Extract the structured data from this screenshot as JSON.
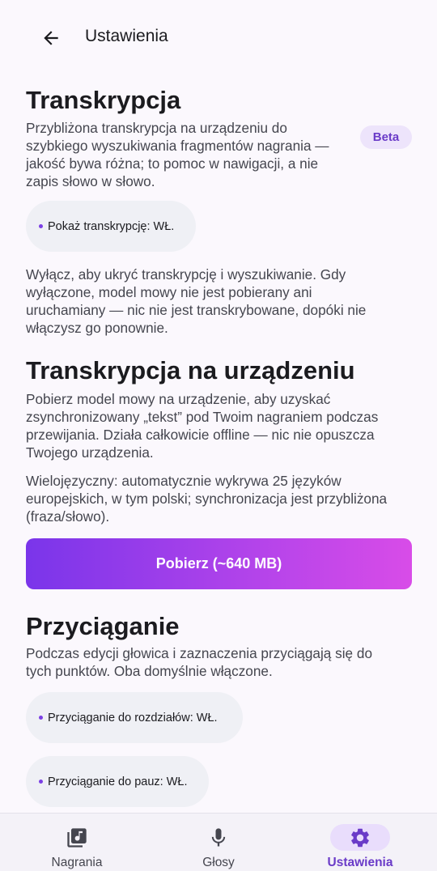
{
  "header": {
    "title": "Ustawienia"
  },
  "sections": {
    "transcription": {
      "title": "Transkrypcja",
      "lines": [
        "Przybliżona transkrypcja na urządzeniu do",
        "szybkiego wyszukiwania fragmentów nagrania —",
        "jakość bywa różna; to pomoc w nawigacji, a nie",
        "zapis słowo w słowo."
      ],
      "badge": "Beta",
      "toggle_label": "Pokaż transkrypcję: WŁ.",
      "note_lines": [
        "Wyłącz, aby ukryć transkrypcję i wyszukiwanie. Gdy",
        "wyłączone, model mowy nie jest pobierany ani",
        "uruchamiany — nic nie jest transkrybowane, dopóki nie",
        "włączysz go ponownie."
      ]
    },
    "on_device": {
      "title": "Transkrypcja na urządzeniu",
      "lines": [
        "Pobierz model mowy na urządzenie, aby uzyskać",
        "zsynchronizowany „tekst” pod Twoim nagraniem podczas",
        "przewijania. Działa całkowicie offline — nic nie opuszcza",
        "Twojego urządzenia."
      ],
      "info_lines": [
        "Wielojęzyczny: automatycznie wykrywa 25 języków",
        "europejskich, w tym polski; synchronizacja jest przybliżona",
        "(fraza/słowo)."
      ],
      "download_label": "Pobierz (~640 MB)"
    },
    "snapping": {
      "title": "Przyciąganie",
      "lines": [
        "Podczas edycji głowica i zaznaczenia przyciągają się do",
        "tych punktów. Oba domyślnie włączone."
      ],
      "chapters_label": "Przyciąganie do rozdziałów: WŁ.",
      "pauses_label": "Przyciąganie do pauz: WŁ."
    }
  },
  "nav": {
    "items": [
      {
        "label": "Nagrania",
        "icon": "music-library-icon"
      },
      {
        "label": "Głosy",
        "icon": "microphone-icon"
      },
      {
        "label": "Ustawienia",
        "icon": "gear-icon",
        "active": true
      }
    ]
  },
  "colors": {
    "accent": "#6a3bc8",
    "accent_soft": "#e9ddfc",
    "gradient_start": "#7a35ea",
    "gradient_end": "#d84ce8"
  }
}
